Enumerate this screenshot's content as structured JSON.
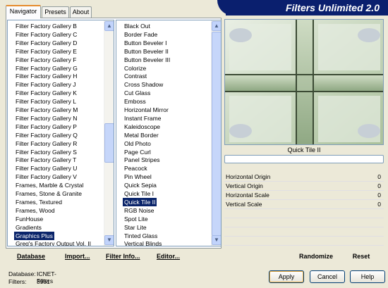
{
  "app": {
    "title": "Filters Unlimited 2.0"
  },
  "tabs": [
    "Navigator",
    "Presets",
    "About"
  ],
  "categories": [
    "Filter Factory Gallery B",
    "Filter Factory Gallery C",
    "Filter Factory Gallery D",
    "Filter Factory Gallery E",
    "Filter Factory Gallery F",
    "Filter Factory Gallery G",
    "Filter Factory Gallery H",
    "Filter Factory Gallery J",
    "Filter Factory Gallery K",
    "Filter Factory Gallery L",
    "Filter Factory Gallery M",
    "Filter Factory Gallery N",
    "Filter Factory Gallery P",
    "Filter Factory Gallery Q",
    "Filter Factory Gallery R",
    "Filter Factory Gallery S",
    "Filter Factory Gallery T",
    "Filter Factory Gallery U",
    "Filter Factory Gallery V",
    "Frames, Marble & Crystal",
    "Frames, Stone & Granite",
    "Frames, Textured",
    "Frames, Wood",
    "FunHouse",
    "Gradients",
    "Graphics Plus",
    "Greg's Factory Output Vol. II"
  ],
  "selected_category": "Graphics Plus",
  "filters": [
    "Black Out",
    "Border Fade",
    "Button Beveler I",
    "Button Beveler II",
    "Button Beveler III",
    "Colorize",
    "Contrast",
    "Cross Shadow",
    "Cut Glass",
    "Emboss",
    "Horizontal Mirror",
    "Instant Frame",
    "Kaleidoscope",
    "Metal Border",
    "Old Photo",
    "Page Curl",
    "Panel Stripes",
    "Peacock",
    "Pin Wheel",
    "Quick Sepia",
    "Quick Tile I",
    "Quick Tile II",
    "RGB Noise",
    "Spot Lite",
    "Star Lite",
    "Tinted Glass",
    "Vertical Blinds"
  ],
  "selected_filter": "Quick Tile II",
  "left_buttons": {
    "database": "Database",
    "import": "Import...",
    "filter_info": "Filter Info...",
    "editor": "Editor..."
  },
  "preview": {
    "filter_name": "Quick Tile II",
    "progress": 0
  },
  "parameters": [
    {
      "label": "Horizontal Origin",
      "value": "0"
    },
    {
      "label": "Vertical Origin",
      "value": "0"
    },
    {
      "label": "Horizontal Scale",
      "value": "0"
    },
    {
      "label": "Vertical Scale",
      "value": "0"
    }
  ],
  "right_buttons": {
    "randomize": "Randomize",
    "reset": "Reset"
  },
  "status": {
    "database_label": "Database:",
    "database_value": "ICNET-Filters",
    "filters_label": "Filters:",
    "filters_value": "3951"
  },
  "dialog_buttons": {
    "apply": "Apply",
    "cancel": "Cancel",
    "help": "Help"
  },
  "colors": {
    "banner": "#0a1f6e",
    "selection": "#0a246a",
    "tab_accent": "#e68b2c"
  }
}
